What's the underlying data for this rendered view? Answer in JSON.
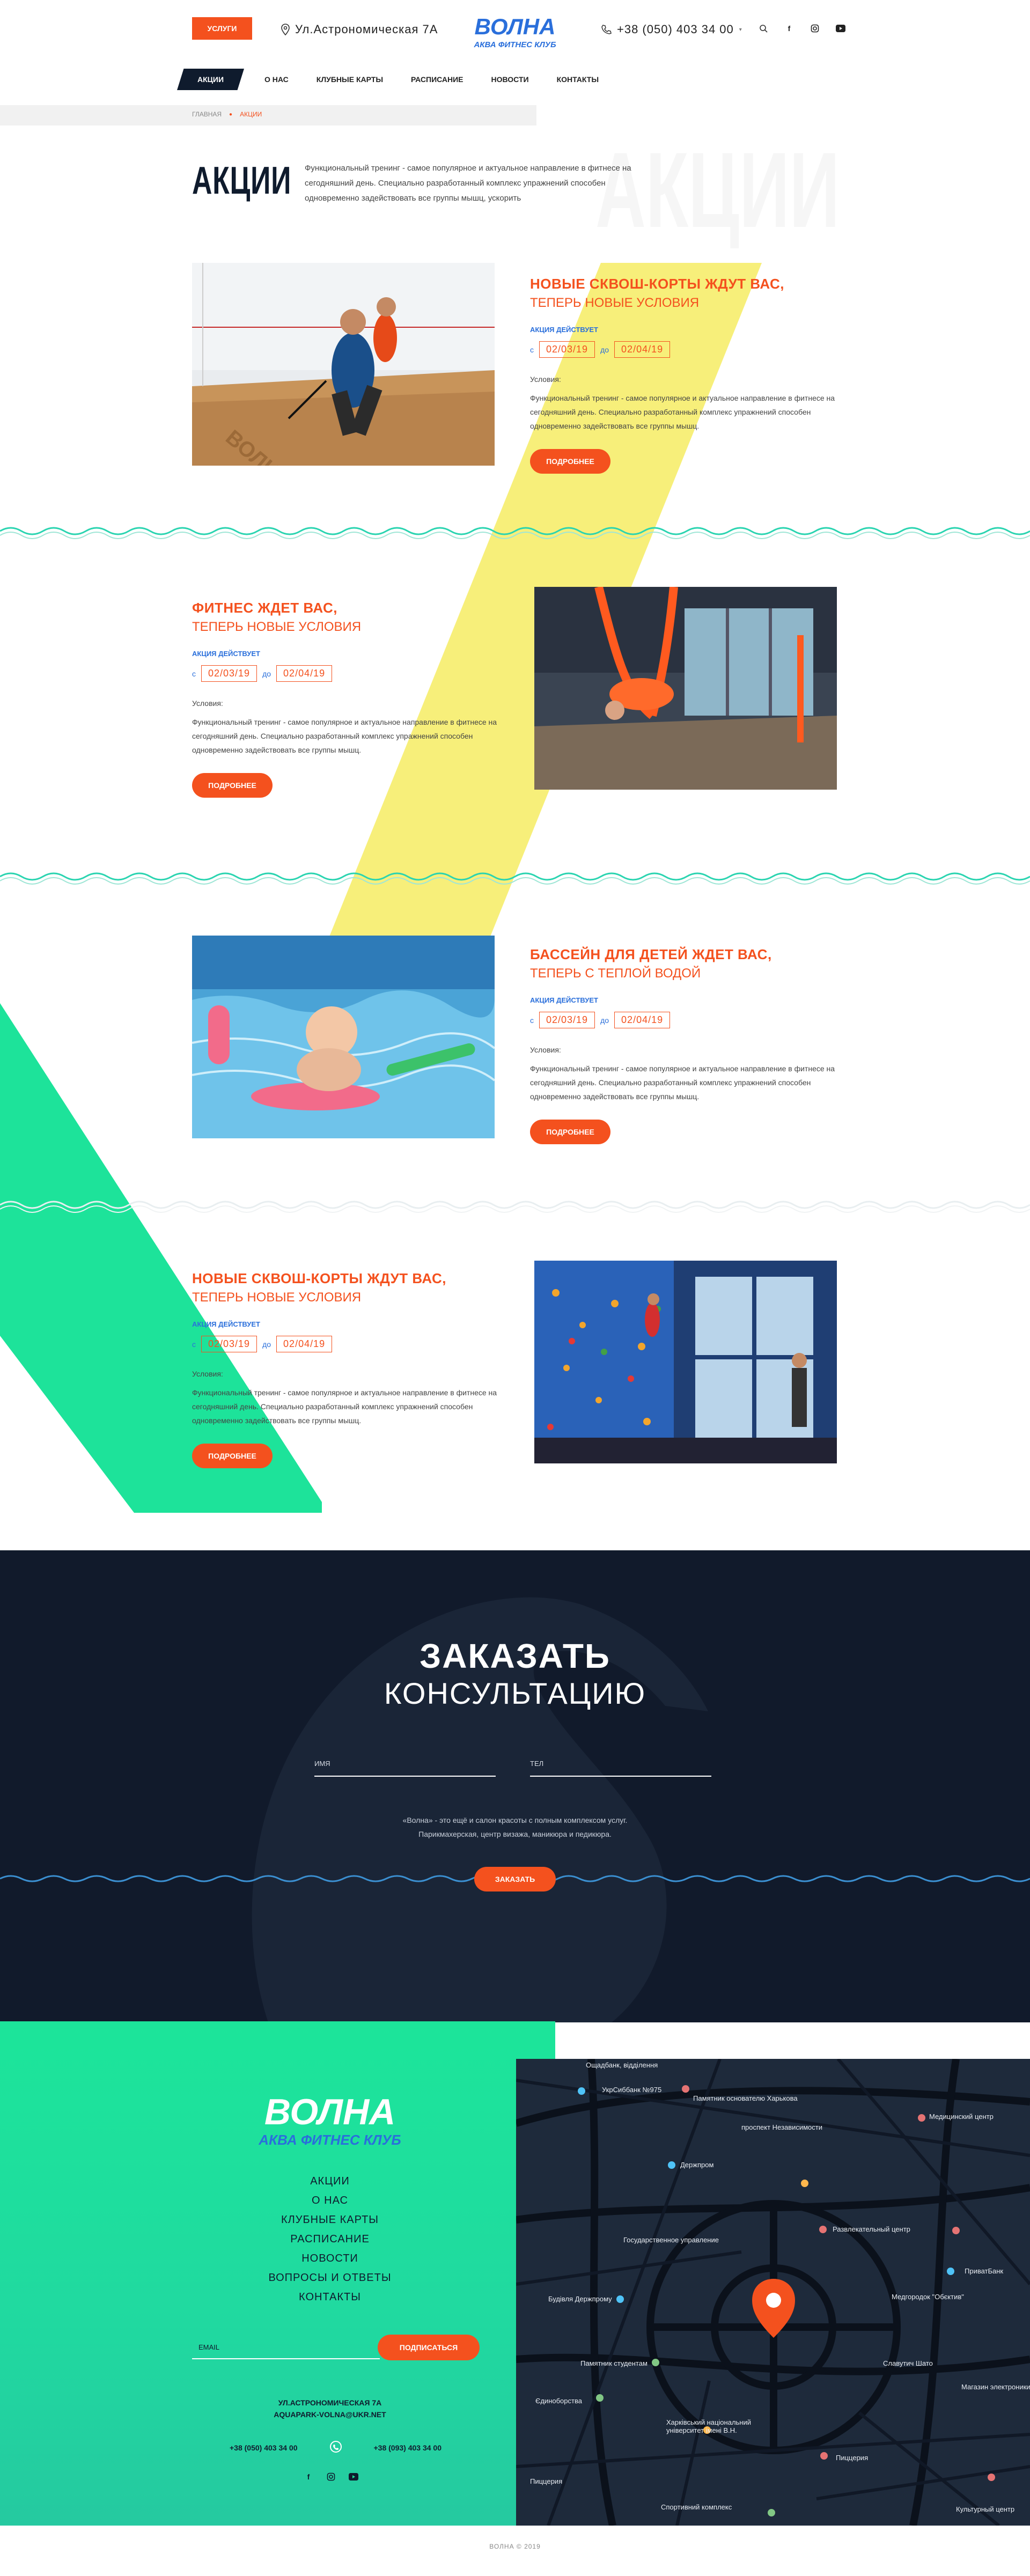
{
  "header": {
    "services_label": "Услуги",
    "address": "Ул.Астрономическая 7А",
    "logo_line1": "ВОЛНА",
    "logo_line2": "АКВА ФИТНЕС КЛУБ",
    "phone": "+38 (050) 403 34 00"
  },
  "nav": {
    "items": [
      {
        "label": "Акции"
      },
      {
        "label": "О нас"
      },
      {
        "label": "Клубные карты"
      },
      {
        "label": "Расписание"
      },
      {
        "label": "Новости"
      },
      {
        "label": "Контакты"
      }
    ]
  },
  "breadcrumb": {
    "home": "Главная",
    "current": "Акции"
  },
  "page": {
    "title": "АКЦИИ",
    "title_bg": "АКЦИИ",
    "intro": "Функциональный тренинг - самое популярное и актуальное направление в фитнесе на сегодняшний день. Специально разработанный комплекс упражнений способен одновременно задействовать все группы мышц, ускорить"
  },
  "promos": [
    {
      "title": "Новые сквош-корты ждут вас,",
      "subtitle": "теперь новые условия",
      "valid_label": "Акция действует",
      "from_label": "с",
      "from": "02/03/19",
      "to_label": "до",
      "to": "02/04/19",
      "cond_label": "Условия:",
      "desc": "Функциональный тренинг - самое популярное и актуальное направление в фитнесе на сегодняшний день. Специально разработанный комплекс упражнений способен одновременно задействовать все группы мышц.",
      "button": "Подробнее"
    },
    {
      "title": "Фитнес ждет вас,",
      "subtitle": "теперь новые условия",
      "valid_label": "Акция действует",
      "from_label": "с",
      "from": "02/03/19",
      "to_label": "до",
      "to": "02/04/19",
      "cond_label": "Условия:",
      "desc": "Функциональный тренинг - самое популярное и актуальное направление в фитнесе на сегодняшний день. Специально разработанный комплекс упражнений способен одновременно задействовать все группы мышц.",
      "button": "Подробнее"
    },
    {
      "title": "Бассейн для детей ждет вас,",
      "subtitle": "теперь с теплой водой",
      "valid_label": "Акция действует",
      "from_label": "с",
      "from": "02/03/19",
      "to_label": "до",
      "to": "02/04/19",
      "cond_label": "Условия:",
      "desc": "Функциональный тренинг - самое популярное и актуальное направление в фитнесе на сегодняшний день. Специально разработанный комплекс упражнений способен одновременно задействовать все группы мышц.",
      "button": "Подробнее"
    },
    {
      "title": "Новые сквош-корты ждут вас,",
      "subtitle": "теперь новые условия",
      "valid_label": "Акция действует",
      "from_label": "с",
      "from": "02/03/19",
      "to_label": "до",
      "to": "02/04/19",
      "cond_label": "Условия:",
      "desc": "Функциональный тренинг - самое популярное и актуальное направление в фитнесе на сегодняшний день. Специально разработанный комплекс упражнений способен одновременно задействовать все группы мышц.",
      "button": "Подробнее"
    }
  ],
  "consult": {
    "title": "ЗАКАЗАТЬ",
    "subtitle": "КОНСУЛЬТАЦИЮ",
    "name_placeholder": "Имя",
    "phone_placeholder": "Тел",
    "note_line1": "«Волна» - это ещё и салон красоты с полным комплексом услуг.",
    "note_line2": "Парикмахерская, центр визажа, маникюра и педикюра.",
    "button": "Заказать"
  },
  "footer": {
    "logo_line1": "ВОЛНА",
    "logo_line2": "АКВА ФИТНЕС КЛУБ",
    "menu": [
      "Акции",
      "О нас",
      "Клубные карты",
      "Расписание",
      "Новости",
      "Вопросы и ответы",
      "Контакты"
    ],
    "email_placeholder": "Email",
    "subscribe": "Подписаться",
    "address": "Ул.Астрономическая 7А",
    "site": "aquapark-volna@ukr.net",
    "phone1": "+38 (050) 403 34 00",
    "phone2": "+38 (093) 403 34 00",
    "copyright": "Волна © 2019"
  },
  "map_labels": {
    "l1": "Ощадбанк, відділення",
    "l2": "УкрСиббанк №975",
    "l3": "Памятник основателю Харькова",
    "l4": "проспект Независимости",
    "l5": "Медицинский центр",
    "l6": "Держпром",
    "l7": "Государственное управление",
    "l8": "Развлекательный центр",
    "l9": "ПриватБанк",
    "l10": "Будівля Держпрому",
    "l11": "Медгородок \"Обєктив\"",
    "l12": "Памятник студентам",
    "l13": "Славутич Шато",
    "l14": "Магазин электроники",
    "l15": "Єдиноборства",
    "l16": "Харківський національний університет імені В.Н.",
    "l17": "Пиццерия",
    "l18": "Пиццерия",
    "l19": "Спортивний комплекс",
    "l20": "Культурный центр"
  },
  "colors": {
    "accent": "#f4511e",
    "navy": "#0f1b2d",
    "yellow": "#f7ef7a",
    "green": "#1de39a",
    "blue": "#2a6fdb"
  }
}
